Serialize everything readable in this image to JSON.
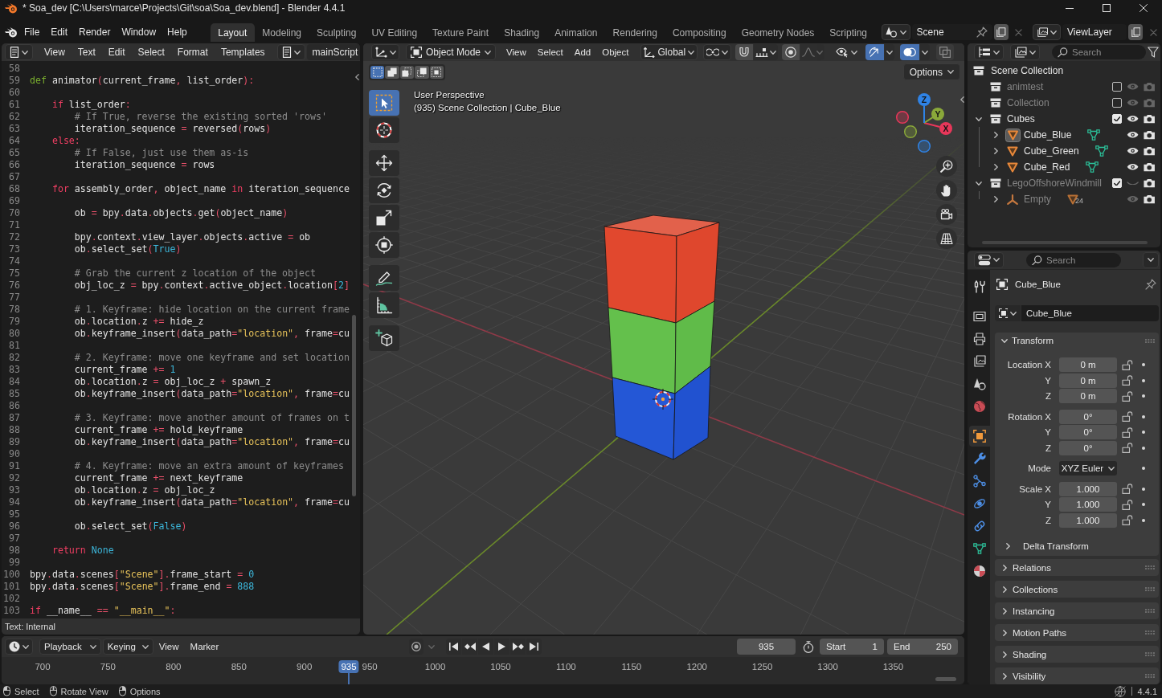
{
  "window": {
    "title": "* Soa_dev [C:\\Users\\marce\\Projects\\Git\\soa\\Soa_dev.blend] - Blender 4.4.1"
  },
  "top_bar": {
    "menus": [
      "File",
      "Edit",
      "Render",
      "Window",
      "Help"
    ],
    "workspaces": [
      {
        "label": "Layout",
        "selected": true
      },
      {
        "label": "Modeling",
        "selected": false
      },
      {
        "label": "Sculpting",
        "selected": false
      },
      {
        "label": "UV Editing",
        "selected": false
      },
      {
        "label": "Texture Paint",
        "selected": false
      },
      {
        "label": "Shading",
        "selected": false
      },
      {
        "label": "Animation",
        "selected": false
      },
      {
        "label": "Rendering",
        "selected": false
      },
      {
        "label": "Compositing",
        "selected": false
      },
      {
        "label": "Geometry Nodes",
        "selected": false
      },
      {
        "label": "Scripting",
        "selected": false
      }
    ],
    "scene": "Scene",
    "view_layer": "ViewLayer"
  },
  "text_editor": {
    "menus": [
      "View",
      "Text",
      "Edit",
      "Select",
      "Format",
      "Templates"
    ],
    "text_block": "mainScript",
    "lines": [
      {
        "number": "58"
      },
      {
        "number": "59",
        "code": [
          {
            "kind": "declaration",
            "text": "def"
          },
          {
            "kind": "plain",
            "text": " animator"
          },
          {
            "kind": "punct",
            "text": "("
          },
          {
            "kind": "plain",
            "text": "current_frame"
          },
          {
            "kind": "punct",
            "text": ","
          },
          {
            "kind": "plain",
            "text": " list_order"
          },
          {
            "kind": "punct",
            "text": "):"
          }
        ]
      },
      {
        "number": "60"
      },
      {
        "number": "61",
        "code": [
          {
            "kind": "keyword",
            "text": "    if"
          },
          {
            "kind": "plain",
            "text": " list_order"
          },
          {
            "kind": "punct",
            "text": ":"
          }
        ]
      },
      {
        "number": "62",
        "code": [
          {
            "kind": "comment",
            "text": "        # If True, reverse the existing sorted 'rows'"
          }
        ]
      },
      {
        "number": "63",
        "code": [
          {
            "kind": "plain",
            "text": "        iteration_sequence "
          },
          {
            "kind": "punct",
            "text": "="
          },
          {
            "kind": "plain",
            "text": " reversed"
          },
          {
            "kind": "punct",
            "text": "("
          },
          {
            "kind": "plain",
            "text": "rows"
          },
          {
            "kind": "punct",
            "text": ")"
          }
        ]
      },
      {
        "number": "64",
        "code": [
          {
            "kind": "keyword",
            "text": "    else"
          },
          {
            "kind": "punct",
            "text": ":"
          }
        ]
      },
      {
        "number": "65",
        "code": [
          {
            "kind": "comment",
            "text": "        # If False, just use them as-is"
          }
        ]
      },
      {
        "number": "66",
        "code": [
          {
            "kind": "plain",
            "text": "        iteration_sequence "
          },
          {
            "kind": "punct",
            "text": "="
          },
          {
            "kind": "plain",
            "text": " rows"
          }
        ]
      },
      {
        "number": "67"
      },
      {
        "number": "68",
        "code": [
          {
            "kind": "keyword",
            "text": "    for"
          },
          {
            "kind": "plain",
            "text": " assembly_order"
          },
          {
            "kind": "punct",
            "text": ","
          },
          {
            "kind": "plain",
            "text": " object_name "
          },
          {
            "kind": "keyword",
            "text": "in"
          },
          {
            "kind": "plain",
            "text": " iteration_sequence"
          }
        ]
      },
      {
        "number": "69"
      },
      {
        "number": "70",
        "code": [
          {
            "kind": "plain",
            "text": "        ob "
          },
          {
            "kind": "punct",
            "text": "="
          },
          {
            "kind": "plain",
            "text": " bpy"
          },
          {
            "kind": "punct",
            "text": "."
          },
          {
            "kind": "plain",
            "text": "data"
          },
          {
            "kind": "punct",
            "text": "."
          },
          {
            "kind": "plain",
            "text": "objects"
          },
          {
            "kind": "punct",
            "text": "."
          },
          {
            "kind": "plain",
            "text": "get"
          },
          {
            "kind": "punct",
            "text": "("
          },
          {
            "kind": "plain",
            "text": "object_name"
          },
          {
            "kind": "punct",
            "text": ")"
          }
        ]
      },
      {
        "number": "71"
      },
      {
        "number": "72",
        "code": [
          {
            "kind": "plain",
            "text": "        bpy"
          },
          {
            "kind": "punct",
            "text": "."
          },
          {
            "kind": "plain",
            "text": "context"
          },
          {
            "kind": "punct",
            "text": "."
          },
          {
            "kind": "plain",
            "text": "view_layer"
          },
          {
            "kind": "punct",
            "text": "."
          },
          {
            "kind": "plain",
            "text": "objects"
          },
          {
            "kind": "punct",
            "text": "."
          },
          {
            "kind": "plain",
            "text": "active "
          },
          {
            "kind": "punct",
            "text": "="
          },
          {
            "kind": "plain",
            "text": " ob"
          }
        ]
      },
      {
        "number": "73",
        "code": [
          {
            "kind": "plain",
            "text": "        ob"
          },
          {
            "kind": "punct",
            "text": "."
          },
          {
            "kind": "plain",
            "text": "select_set"
          },
          {
            "kind": "punct",
            "text": "("
          },
          {
            "kind": "constant",
            "text": "True"
          },
          {
            "kind": "punct",
            "text": ")"
          }
        ]
      },
      {
        "number": "74"
      },
      {
        "number": "75",
        "code": [
          {
            "kind": "comment",
            "text": "        # Grab the current z location of the object"
          }
        ]
      },
      {
        "number": "76",
        "code": [
          {
            "kind": "plain",
            "text": "        obj_loc_z "
          },
          {
            "kind": "punct",
            "text": "="
          },
          {
            "kind": "plain",
            "text": " bpy"
          },
          {
            "kind": "punct",
            "text": "."
          },
          {
            "kind": "plain",
            "text": "context"
          },
          {
            "kind": "punct",
            "text": "."
          },
          {
            "kind": "plain",
            "text": "active_object"
          },
          {
            "kind": "punct",
            "text": "."
          },
          {
            "kind": "plain",
            "text": "location"
          },
          {
            "kind": "punct",
            "text": "["
          },
          {
            "kind": "constant",
            "text": "2"
          },
          {
            "kind": "punct",
            "text": "]"
          }
        ]
      },
      {
        "number": "77"
      },
      {
        "number": "78",
        "code": [
          {
            "kind": "comment",
            "text": "        # 1. Keyframe: hide location on the current frame"
          }
        ]
      },
      {
        "number": "79",
        "code": [
          {
            "kind": "plain",
            "text": "        ob"
          },
          {
            "kind": "punct",
            "text": "."
          },
          {
            "kind": "plain",
            "text": "location"
          },
          {
            "kind": "punct",
            "text": "."
          },
          {
            "kind": "plain",
            "text": "z "
          },
          {
            "kind": "punct",
            "text": "+="
          },
          {
            "kind": "plain",
            "text": " hide_z"
          }
        ]
      },
      {
        "number": "80",
        "code": [
          {
            "kind": "plain",
            "text": "        ob"
          },
          {
            "kind": "punct",
            "text": "."
          },
          {
            "kind": "plain",
            "text": "keyframe_insert"
          },
          {
            "kind": "punct",
            "text": "("
          },
          {
            "kind": "plain",
            "text": "data_path"
          },
          {
            "kind": "punct",
            "text": "="
          },
          {
            "kind": "string",
            "text": "\"location\""
          },
          {
            "kind": "punct",
            "text": ","
          },
          {
            "kind": "plain",
            "text": " frame"
          },
          {
            "kind": "punct",
            "text": "="
          },
          {
            "kind": "plain",
            "text": "cu"
          }
        ]
      },
      {
        "number": "81"
      },
      {
        "number": "82",
        "code": [
          {
            "kind": "comment",
            "text": "        # 2. Keyframe: move one keyframe and set location"
          }
        ]
      },
      {
        "number": "83",
        "code": [
          {
            "kind": "plain",
            "text": "        current_frame "
          },
          {
            "kind": "punct",
            "text": "+="
          },
          {
            "kind": "constant",
            "text": " 1"
          }
        ]
      },
      {
        "number": "84",
        "code": [
          {
            "kind": "plain",
            "text": "        ob"
          },
          {
            "kind": "punct",
            "text": "."
          },
          {
            "kind": "plain",
            "text": "location"
          },
          {
            "kind": "punct",
            "text": "."
          },
          {
            "kind": "plain",
            "text": "z "
          },
          {
            "kind": "punct",
            "text": "="
          },
          {
            "kind": "plain",
            "text": " obj_loc_z "
          },
          {
            "kind": "punct",
            "text": "+"
          },
          {
            "kind": "plain",
            "text": " spawn_z"
          }
        ]
      },
      {
        "number": "85",
        "code": [
          {
            "kind": "plain",
            "text": "        ob"
          },
          {
            "kind": "punct",
            "text": "."
          },
          {
            "kind": "plain",
            "text": "keyframe_insert"
          },
          {
            "kind": "punct",
            "text": "("
          },
          {
            "kind": "plain",
            "text": "data_path"
          },
          {
            "kind": "punct",
            "text": "="
          },
          {
            "kind": "string",
            "text": "\"location\""
          },
          {
            "kind": "punct",
            "text": ","
          },
          {
            "kind": "plain",
            "text": " frame"
          },
          {
            "kind": "punct",
            "text": "="
          },
          {
            "kind": "plain",
            "text": "cu"
          }
        ]
      },
      {
        "number": "86"
      },
      {
        "number": "87",
        "code": [
          {
            "kind": "comment",
            "text": "        # 3. Keyframe: move another amount of frames on t"
          }
        ]
      },
      {
        "number": "88",
        "code": [
          {
            "kind": "plain",
            "text": "        current_frame "
          },
          {
            "kind": "punct",
            "text": "+="
          },
          {
            "kind": "plain",
            "text": " hold_keyframe"
          }
        ]
      },
      {
        "number": "89",
        "code": [
          {
            "kind": "plain",
            "text": "        ob"
          },
          {
            "kind": "punct",
            "text": "."
          },
          {
            "kind": "plain",
            "text": "keyframe_insert"
          },
          {
            "kind": "punct",
            "text": "("
          },
          {
            "kind": "plain",
            "text": "data_path"
          },
          {
            "kind": "punct",
            "text": "="
          },
          {
            "kind": "string",
            "text": "\"location\""
          },
          {
            "kind": "punct",
            "text": ","
          },
          {
            "kind": "plain",
            "text": " frame"
          },
          {
            "kind": "punct",
            "text": "="
          },
          {
            "kind": "plain",
            "text": "cu"
          }
        ]
      },
      {
        "number": "90"
      },
      {
        "number": "91",
        "code": [
          {
            "kind": "comment",
            "text": "        # 4. Keyframe: move an extra amount of keyframes"
          }
        ]
      },
      {
        "number": "92",
        "code": [
          {
            "kind": "plain",
            "text": "        current_frame "
          },
          {
            "kind": "punct",
            "text": "+="
          },
          {
            "kind": "plain",
            "text": " next_keyframe"
          }
        ]
      },
      {
        "number": "93",
        "code": [
          {
            "kind": "plain",
            "text": "        ob"
          },
          {
            "kind": "punct",
            "text": "."
          },
          {
            "kind": "plain",
            "text": "location"
          },
          {
            "kind": "punct",
            "text": "."
          },
          {
            "kind": "plain",
            "text": "z "
          },
          {
            "kind": "punct",
            "text": "="
          },
          {
            "kind": "plain",
            "text": " obj_loc_z"
          }
        ]
      },
      {
        "number": "94",
        "code": [
          {
            "kind": "plain",
            "text": "        ob"
          },
          {
            "kind": "punct",
            "text": "."
          },
          {
            "kind": "plain",
            "text": "keyframe_insert"
          },
          {
            "kind": "punct",
            "text": "("
          },
          {
            "kind": "plain",
            "text": "data_path"
          },
          {
            "kind": "punct",
            "text": "="
          },
          {
            "kind": "string",
            "text": "\"location\""
          },
          {
            "kind": "punct",
            "text": ","
          },
          {
            "kind": "plain",
            "text": " frame"
          },
          {
            "kind": "punct",
            "text": "="
          },
          {
            "kind": "plain",
            "text": "cu"
          }
        ]
      },
      {
        "number": "95"
      },
      {
        "number": "96",
        "code": [
          {
            "kind": "plain",
            "text": "        ob"
          },
          {
            "kind": "punct",
            "text": "."
          },
          {
            "kind": "plain",
            "text": "select_set"
          },
          {
            "kind": "punct",
            "text": "("
          },
          {
            "kind": "constant",
            "text": "False"
          },
          {
            "kind": "punct",
            "text": ")"
          }
        ]
      },
      {
        "number": "97"
      },
      {
        "number": "98",
        "code": [
          {
            "kind": "keyword",
            "text": "    return"
          },
          {
            "kind": "constant",
            "text": " None"
          }
        ]
      },
      {
        "number": "99"
      },
      {
        "number": "100",
        "code": [
          {
            "kind": "plain",
            "text": "bpy"
          },
          {
            "kind": "punct",
            "text": "."
          },
          {
            "kind": "plain",
            "text": "data"
          },
          {
            "kind": "punct",
            "text": "."
          },
          {
            "kind": "plain",
            "text": "scenes"
          },
          {
            "kind": "punct",
            "text": "["
          },
          {
            "kind": "string",
            "text": "\"Scene\""
          },
          {
            "kind": "punct",
            "text": "]."
          },
          {
            "kind": "plain",
            "text": "frame_start "
          },
          {
            "kind": "punct",
            "text": "="
          },
          {
            "kind": "constant",
            "text": " 0"
          }
        ]
      },
      {
        "number": "101",
        "code": [
          {
            "kind": "plain",
            "text": "bpy"
          },
          {
            "kind": "punct",
            "text": "."
          },
          {
            "kind": "plain",
            "text": "data"
          },
          {
            "kind": "punct",
            "text": "."
          },
          {
            "kind": "plain",
            "text": "scenes"
          },
          {
            "kind": "punct",
            "text": "["
          },
          {
            "kind": "string",
            "text": "\"Scene\""
          },
          {
            "kind": "punct",
            "text": "]."
          },
          {
            "kind": "plain",
            "text": "frame_end "
          },
          {
            "kind": "punct",
            "text": "="
          },
          {
            "kind": "constant",
            "text": " 888"
          }
        ]
      },
      {
        "number": "102"
      },
      {
        "number": "103",
        "code": [
          {
            "kind": "keyword",
            "text": "if"
          },
          {
            "kind": "plain",
            "text": " __name__ "
          },
          {
            "kind": "punct",
            "text": "=="
          },
          {
            "kind": "string",
            "text": " \"__main__\""
          },
          {
            "kind": "punct",
            "text": ":"
          }
        ]
      }
    ],
    "footer": "Text: Internal"
  },
  "viewport": {
    "mode": "Object Mode",
    "menus": [
      "View",
      "Select",
      "Add",
      "Object"
    ],
    "header_controls": [
      {
        "kind": "orientation",
        "label": "Global"
      },
      {
        "kind": "pivot"
      },
      {
        "kind": "snap",
        "on": false
      },
      {
        "kind": "proportional",
        "on": false
      },
      {
        "kind": "selectability"
      },
      {
        "kind": "gizmos",
        "on": true
      },
      {
        "kind": "overlays",
        "on": true
      },
      {
        "kind": "xray",
        "on": false
      }
    ],
    "select_modes": [
      {
        "kind": "set",
        "selected": true
      },
      {
        "kind": "extend",
        "selected": false
      },
      {
        "kind": "subtract",
        "selected": false
      },
      {
        "kind": "difference",
        "selected": false
      },
      {
        "kind": "intersect",
        "selected": false
      }
    ],
    "options": "Options",
    "tool_groups": [
      {
        "tools": [
          {
            "kind": "select-box",
            "selected": true
          },
          {
            "kind": "cursor",
            "selected": false
          }
        ]
      },
      {
        "tools": [
          {
            "kind": "move",
            "selected": false
          },
          {
            "kind": "rotate",
            "selected": false
          },
          {
            "kind": "scale",
            "selected": false
          },
          {
            "kind": "transform",
            "selected": false
          }
        ]
      },
      {
        "tools": [
          {
            "kind": "annotate",
            "selected": false
          },
          {
            "kind": "measure",
            "selected": false
          }
        ]
      },
      {
        "tools": [
          {
            "kind": "add-cube",
            "selected": false
          }
        ]
      }
    ],
    "info": [
      "User Perspective",
      "(935) Scene Collection | Cube_Blue"
    ],
    "axes": [
      {
        "label": "X",
        "color": "#e8375a"
      },
      {
        "label": "Y",
        "color": "#8aa83a"
      },
      {
        "label": "Z",
        "color": "#2f83e6"
      }
    ]
  },
  "outliner": {
    "search_placeholder": "Search",
    "tree": [
      {
        "name": "Scene Collection",
        "kind": "scene-collection",
        "children": [
          {
            "name": "animtest",
            "kind": "collection",
            "checked": false,
            "visible": true,
            "dimmed": true
          },
          {
            "name": "Collection",
            "kind": "collection",
            "checked": false,
            "visible": true,
            "dimmed": true
          },
          {
            "name": "Cubes",
            "kind": "collection",
            "checked": true,
            "visible": true,
            "dimmed": false,
            "expanded": true,
            "children": [
              {
                "name": "Cube_Blue",
                "kind": "mesh",
                "active": true,
                "visible": true,
                "dimmed": false,
                "expanded": false,
                "collapsed_children": [
                  {
                    "kind": "mesh-data"
                  }
                ]
              },
              {
                "name": "Cube_Green",
                "kind": "mesh",
                "active": false,
                "visible": true,
                "dimmed": false,
                "expanded": false,
                "collapsed_children": [
                  {
                    "kind": "mesh-data"
                  }
                ]
              },
              {
                "name": "Cube_Red",
                "kind": "mesh",
                "active": false,
                "visible": true,
                "dimmed": false,
                "expanded": false,
                "collapsed_children": [
                  {
                    "kind": "mesh-data"
                  }
                ]
              }
            ]
          },
          {
            "name": "LegoOffshoreWindmill",
            "kind": "collection",
            "checked": true,
            "visible": false,
            "dimmed": true,
            "expanded": true,
            "children": [
              {
                "name": "Empty",
                "kind": "empty",
                "active": false,
                "visible": true,
                "dimmed": true,
                "expanded": false,
                "collapsed_children": [
                  {
                    "kind": "mesh-object",
                    "count": "24"
                  }
                ]
              }
            ]
          }
        ]
      }
    ]
  },
  "properties": {
    "search_placeholder": "Search",
    "tab_groups": [
      {
        "tabs": [
          {
            "kind": "tool",
            "selected": false
          }
        ]
      },
      {
        "tabs": [
          {
            "kind": "render",
            "selected": false
          },
          {
            "kind": "output",
            "selected": false
          },
          {
            "kind": "view-layer",
            "selected": false
          },
          {
            "kind": "scene",
            "selected": false
          },
          {
            "kind": "world",
            "selected": false
          }
        ]
      },
      {
        "tabs": [
          {
            "kind": "object",
            "selected": true
          },
          {
            "kind": "modifiers",
            "selected": false
          },
          {
            "kind": "particles",
            "selected": false
          },
          {
            "kind": "physics",
            "selected": false
          },
          {
            "kind": "constraints",
            "selected": false
          },
          {
            "kind": "data",
            "selected": false
          },
          {
            "kind": "material",
            "selected": false
          }
        ]
      }
    ],
    "object_name": "Cube_Blue",
    "datablock": "Cube_Blue",
    "transform": {
      "title": "Transform",
      "expanded": true,
      "groups": [
        {
          "rows": [
            {
              "kind": "number",
              "label": "Location X",
              "value": "0 m",
              "locked": false,
              "keyed": false
            },
            {
              "kind": "number",
              "label": "Y",
              "value": "0 m",
              "locked": false,
              "keyed": false
            },
            {
              "kind": "number",
              "label": "Z",
              "value": "0 m",
              "locked": false,
              "keyed": false
            }
          ]
        },
        {
          "rows": [
            {
              "kind": "number",
              "label": "Rotation X",
              "value": "0°",
              "locked": false,
              "keyed": false
            },
            {
              "kind": "number",
              "label": "Y",
              "value": "0°",
              "locked": false,
              "keyed": false
            },
            {
              "kind": "number",
              "label": "Z",
              "value": "0°",
              "locked": false,
              "keyed": false
            }
          ]
        },
        {
          "rows": [
            {
              "kind": "dropdown",
              "label": "Mode",
              "value": "XYZ Euler",
              "keyed": false
            }
          ]
        },
        {
          "rows": [
            {
              "kind": "number",
              "label": "Scale X",
              "value": "1.000",
              "locked": false,
              "keyed": false
            },
            {
              "kind": "number",
              "label": "Y",
              "value": "1.000",
              "locked": false,
              "keyed": false
            },
            {
              "kind": "number",
              "label": "Z",
              "value": "1.000",
              "locked": false,
              "keyed": false
            }
          ]
        }
      ],
      "subpanels": [
        {
          "title": "Delta Transform",
          "expanded": false
        }
      ]
    },
    "panels": [
      {
        "title": "Relations",
        "expanded": false
      },
      {
        "title": "Collections",
        "expanded": false
      },
      {
        "title": "Instancing",
        "expanded": false
      },
      {
        "title": "Motion Paths",
        "expanded": false
      },
      {
        "title": "Shading",
        "expanded": false
      },
      {
        "title": "Visibility",
        "expanded": false
      }
    ]
  },
  "timeline": {
    "menus": [
      {
        "kind": "dropdown",
        "label": "Playback"
      },
      {
        "kind": "dropdown",
        "label": "Keying"
      },
      {
        "kind": "menu",
        "label": "View"
      },
      {
        "kind": "menu",
        "label": "Marker"
      }
    ],
    "auto_keying": {
      "on": false
    },
    "current_frame": "935",
    "preview_range": {
      "on": false
    },
    "start": {
      "label": "Start",
      "value": "1"
    },
    "end": {
      "label": "End",
      "value": "250"
    },
    "ruler": [
      "700",
      "750",
      "800",
      "850",
      "900",
      "950",
      "1000",
      "1050",
      "1100",
      "1150",
      "1200",
      "1250",
      "1300",
      "1350"
    ],
    "playhead": {
      "label": "935",
      "level": 0.3606
    }
  },
  "status_bar": {
    "hints": [
      {
        "kind": "left",
        "label": "Select"
      },
      {
        "kind": "middle",
        "label": "Rotate View"
      },
      {
        "kind": "right",
        "label": "Options"
      }
    ],
    "version": "4.4.1"
  }
}
